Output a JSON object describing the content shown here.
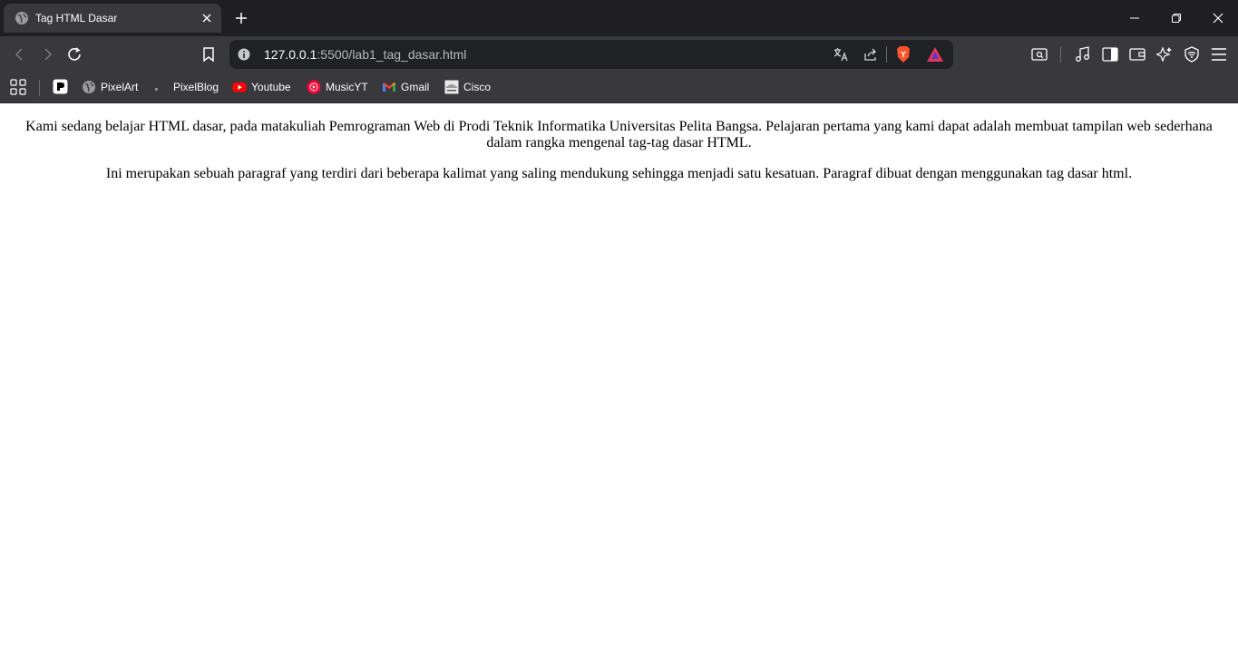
{
  "browser": {
    "tab": {
      "title": "Tag HTML Dasar"
    },
    "address_bar": {
      "url_host": "127.0.0.1",
      "url_rest": ":5500/lab1_tag_dasar.html"
    },
    "bookmarks": [
      {
        "label": "PixelArt",
        "icon": "globe-icon"
      },
      {
        "label": "PixelBlog",
        "icon": "blog-icon"
      },
      {
        "label": "Youtube",
        "icon": "youtube-icon"
      },
      {
        "label": "MusicYT",
        "icon": "music-youtube-icon"
      },
      {
        "label": "Gmail",
        "icon": "gmail-icon"
      },
      {
        "label": "Cisco",
        "icon": "cisco-icon"
      }
    ],
    "colors": {
      "titlebar": "#1f1f23",
      "toolbar": "#38383d",
      "urlbar": "#202124",
      "brave": "#fb542b"
    }
  },
  "page": {
    "paragraphs": [
      "Kami sedang belajar HTML dasar, pada matakuliah Pemrograman Web di Prodi Teknik Informatika Universitas Pelita Bangsa. Pelajaran pertama yang kami dapat adalah membuat tampilan web sederhana dalam rangka mengenal tag-tag dasar HTML.",
      "Ini merupakan sebuah paragraf yang terdiri dari beberapa kalimat yang saling mendukung sehingga menjadi satu kesatuan. Paragraf dibuat dengan menggunakan tag dasar html."
    ]
  }
}
